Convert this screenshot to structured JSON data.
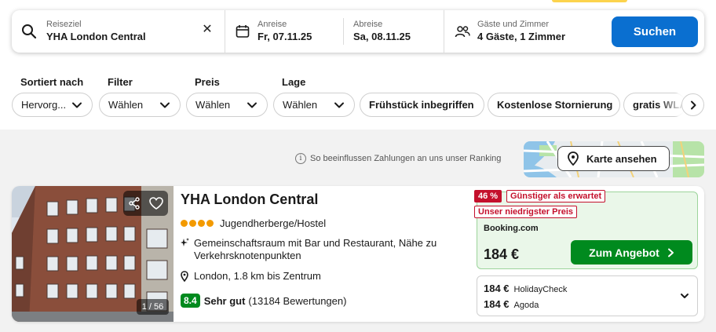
{
  "search": {
    "destination_label": "Reiseziel",
    "destination_value": "YHA London Central",
    "checkin_label": "Anreise",
    "checkin_value": "Fr, 07.11.25",
    "checkout_label": "Abreise",
    "checkout_value": "Sa, 08.11.25",
    "guests_label": "Gäste und Zimmer",
    "guests_value": "4 Gäste, 1 Zimmer",
    "search_button": "Suchen"
  },
  "filters": {
    "sort": {
      "label": "Sortiert nach",
      "value": "Hervorg..."
    },
    "filter": {
      "label": "Filter",
      "value": "Wählen"
    },
    "price": {
      "label": "Preis",
      "value": "Wählen"
    },
    "location": {
      "label": "Lage",
      "value": "Wählen"
    },
    "chips": [
      "Frühstück inbegriffen",
      "Kostenlose Stornierung",
      "gratis WLAN"
    ]
  },
  "ranking_info": "So beeinflussen Zahlungen an uns unser Ranking",
  "map_button": "Karte ansehen",
  "result": {
    "name": "YHA London Central",
    "stars": 4,
    "type": "Jugendherberge/Hostel",
    "amenities": "Gemeinschaftsraum mit Bar und Restaurant, Nähe zu Verkehrsknotenpunkten",
    "location": "London, 1.8 km bis Zentrum",
    "score": "8.4",
    "rating_text": "Sehr gut",
    "reviews": "(13184 Bewertungen)",
    "image_counter": "1 / 56",
    "deal": {
      "discount_badge": "46 %",
      "discount_text": "Günstiger als erwartet",
      "lowest_badge": "Unser niedrigster Preis",
      "provider": "Booking.com",
      "price": "184 €",
      "button": "Zum Angebot"
    },
    "other_offers": [
      {
        "price": "184 €",
        "provider": "HolidayCheck"
      },
      {
        "price": "184 €",
        "provider": "Agoda"
      }
    ]
  },
  "colors": {
    "primary_blue": "#0a6fd0",
    "deal_green": "#008a1e",
    "badge_red": "#c4102c",
    "star_orange": "#f39a00"
  }
}
